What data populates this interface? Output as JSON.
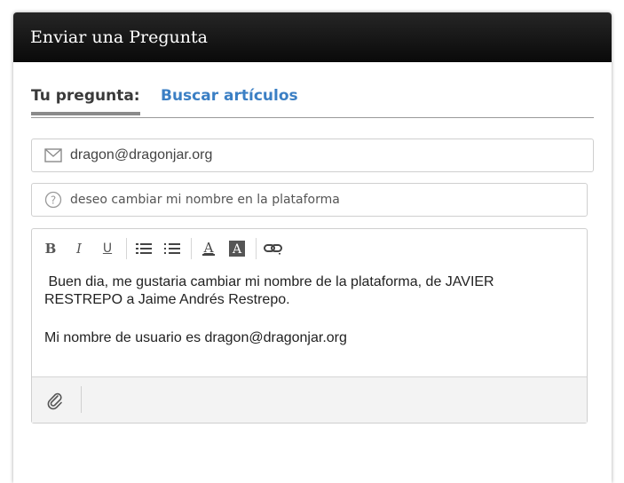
{
  "header": {
    "title": "Enviar una Pregunta"
  },
  "tabs": [
    {
      "label": "Tu pregunta:",
      "active": true
    },
    {
      "label": "Buscar artículos",
      "active": false
    }
  ],
  "form": {
    "email": {
      "value": "dragon@dragonjar.org",
      "icon": "envelope-icon"
    },
    "subject": {
      "value": "deseo cambiar mi nombre en la plataforma",
      "icon": "question-circle-icon"
    }
  },
  "editor": {
    "toolbar": [
      "bold",
      "italic",
      "underline",
      "bulleted-list",
      "numbered-list",
      "text-color",
      "background-color",
      "link"
    ],
    "body": {
      "line1": " Buen dia, me gustaria cambiar mi nombre de la plataforma, de JAVIER",
      "line2": "RESTREPO a Jaime Andrés Restrepo.",
      "line3": "Mi nombre de usuario es dragon@dragonjar.org"
    },
    "footer": {
      "attach_icon": "paperclip-icon"
    }
  },
  "colors": {
    "header_bg": "#111111",
    "tab_link": "#3b7fc4",
    "text": "#222222"
  }
}
